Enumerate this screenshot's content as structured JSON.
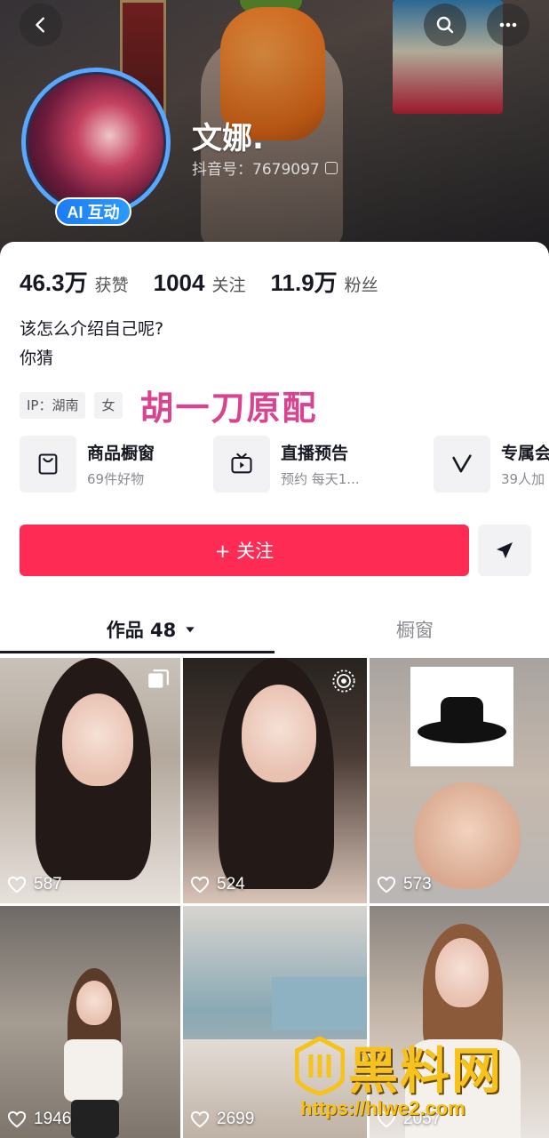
{
  "profile": {
    "nickname": "文娜.",
    "douyin_id": "抖音号：7679097",
    "ai_badge": "AI 互动"
  },
  "stats": [
    {
      "value": "46.3万",
      "label": "获赞"
    },
    {
      "value": "1004",
      "label": "关注"
    },
    {
      "value": "11.9万",
      "label": "粉丝"
    }
  ],
  "bio": {
    "line1": "该怎么介绍自己呢?",
    "line2": "你猜"
  },
  "tags": {
    "ip": "IP：湖南",
    "gender": "女",
    "overlay_text": "胡一刀原配"
  },
  "shortcuts": [
    {
      "title": "商品橱窗",
      "subtitle": "69件好物",
      "icon": "shop-window-icon"
    },
    {
      "title": "直播预告",
      "subtitle": "预约 每天1...",
      "icon": "tv-icon"
    },
    {
      "title": "专属会",
      "subtitle": "39人加",
      "icon": "vip-v-icon"
    }
  ],
  "actions": {
    "follow_label": "+ 关注",
    "share_icon": "send-icon"
  },
  "tabs": {
    "works_label": "作品 48",
    "window_label": "橱窗"
  },
  "videos": [
    {
      "likes": "587"
    },
    {
      "likes": "524"
    },
    {
      "likes": "573"
    },
    {
      "likes": "1946"
    },
    {
      "likes": "2699"
    },
    {
      "likes": "2057"
    }
  ],
  "watermark": {
    "name": "黑料网",
    "url": "https://hlwe2.com"
  },
  "colors": {
    "follow": "#fe2c55",
    "ai_badge": "#1c7cf5",
    "overlay_text": "#d9438f",
    "watermark": "#f6c21b"
  }
}
